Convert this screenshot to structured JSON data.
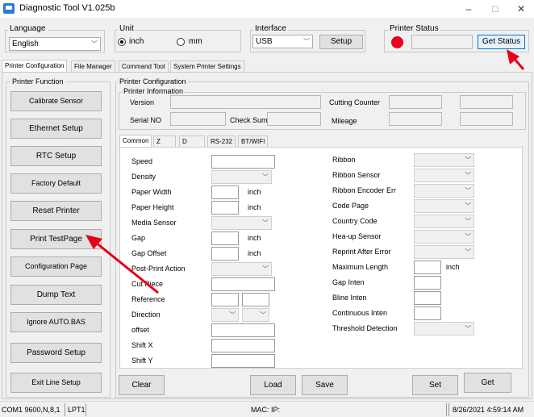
{
  "window": {
    "title": "Diagnostic Tool V1.025b",
    "minimize": "–",
    "maximize": "□",
    "close": "✕"
  },
  "language": {
    "label": "Language",
    "value": "English"
  },
  "unit": {
    "label": "Unit",
    "inch": "inch",
    "mm": "mm",
    "selected": "inch"
  },
  "interface": {
    "label": "Interface",
    "value": "USB",
    "setup": "Setup"
  },
  "printer_status": {
    "label": "Printer  Status",
    "indicator_color": "#e8001c",
    "get_status": "Get Status"
  },
  "tabs": [
    "Printer Configuration",
    "File Manager",
    "Command Tool",
    "System Printer Settings"
  ],
  "printer_function": {
    "label": "Printer  Function",
    "buttons": [
      "Calibrate Sensor",
      "Ethernet Setup",
      "RTC Setup",
      "Factory Default",
      "Reset Printer",
      "Print TestPage",
      "Configuration Page",
      "Dump Text",
      "Ignore AUTO.BAS",
      "Password Setup",
      "Exit Line Setup"
    ]
  },
  "printer_configuration": {
    "label": "Printer Configuration"
  },
  "printer_information": {
    "label": "Printer Information",
    "version": "Version",
    "serial_no": "Serial NO",
    "check_sum": "Check Sum",
    "cutting_counter": "Cutting Counter",
    "mileage": "Mileage"
  },
  "subtabs": [
    "Common",
    "Z",
    "D",
    "RS-232",
    "BT/WIFI"
  ],
  "common_left": [
    {
      "label": "Speed",
      "kind": "text",
      "unit": ""
    },
    {
      "label": "Density",
      "kind": "combo",
      "unit": ""
    },
    {
      "label": "Paper Width",
      "kind": "short",
      "unit": "inch"
    },
    {
      "label": "Paper Height",
      "kind": "short",
      "unit": "inch"
    },
    {
      "label": "Media Sensor",
      "kind": "combo",
      "unit": ""
    },
    {
      "label": "Gap",
      "kind": "short",
      "unit": "inch"
    },
    {
      "label": "Gap Offset",
      "kind": "short",
      "unit": "inch"
    },
    {
      "label": "Post-Print Action",
      "kind": "combo",
      "unit": ""
    },
    {
      "label": "Cut Piece",
      "kind": "text",
      "unit": ""
    },
    {
      "label": "Reference",
      "kind": "pair",
      "unit": ""
    },
    {
      "label": "Direction",
      "kind": "combopair",
      "unit": ""
    },
    {
      "label": "offset",
      "kind": "text",
      "unit": ""
    },
    {
      "label": "Shift X",
      "kind": "text",
      "unit": ""
    },
    {
      "label": "Shift Y",
      "kind": "text",
      "unit": ""
    }
  ],
  "common_right": [
    {
      "label": "Ribbon",
      "kind": "combo",
      "unit": ""
    },
    {
      "label": "Ribbon  Sensor",
      "kind": "combo",
      "unit": ""
    },
    {
      "label": "Ribbon Encoder Err",
      "kind": "combo",
      "unit": ""
    },
    {
      "label": "Code Page",
      "kind": "combo",
      "unit": ""
    },
    {
      "label": "Country Code",
      "kind": "combo",
      "unit": ""
    },
    {
      "label": "Hea-up  Sensor",
      "kind": "combo",
      "unit": ""
    },
    {
      "label": "Reprint After  Error",
      "kind": "combo",
      "unit": ""
    },
    {
      "label": "Maximum Length",
      "kind": "short",
      "unit": "inch"
    },
    {
      "label": "Gap Inten",
      "kind": "short",
      "unit": ""
    },
    {
      "label": "Bline  Inten",
      "kind": "short",
      "unit": ""
    },
    {
      "label": "Continuous  Inten",
      "kind": "short",
      "unit": ""
    },
    {
      "label": "Threshold  Detection",
      "kind": "combo",
      "unit": ""
    }
  ],
  "actions": {
    "clear": "Clear",
    "load": "Load",
    "save": "Save",
    "set": "Set",
    "get": "Get"
  },
  "statusbar": {
    "port": "COM1 9600,N,8,1",
    "lpt": "LPT1",
    "mac": "MAC: IP:",
    "datetime": "8/26/2021 4:59:14 AM"
  },
  "annotation_color": "#e8001c"
}
